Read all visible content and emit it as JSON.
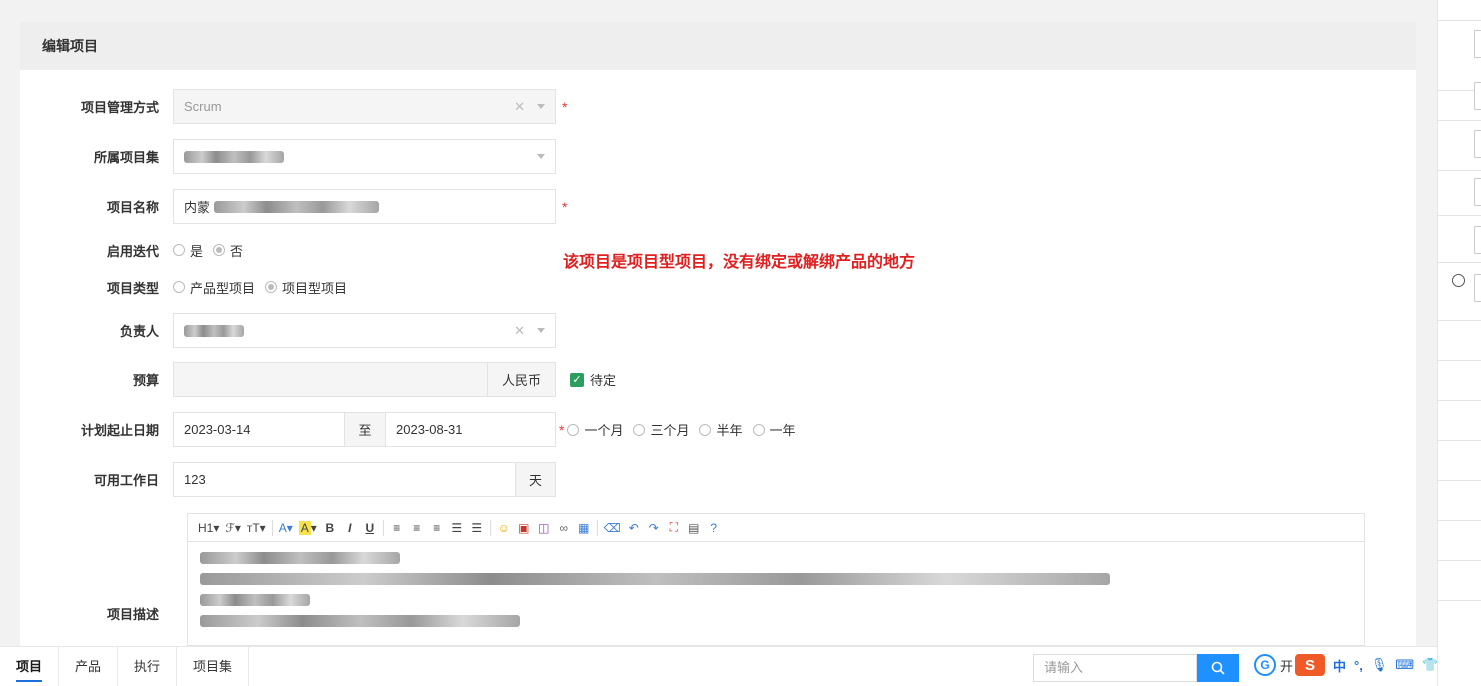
{
  "panel": {
    "title": "编辑项目"
  },
  "form": {
    "management": {
      "label": "项目管理方式",
      "value": "Scrum",
      "required": "*"
    },
    "program": {
      "label": "所属项目集"
    },
    "name": {
      "label": "项目名称",
      "prefix": "内蒙",
      "required": "*"
    },
    "iteration": {
      "label": "启用迭代",
      "options": [
        "是",
        "否"
      ]
    },
    "type": {
      "label": "项目类型",
      "options": [
        "产品型项目",
        "项目型项目"
      ]
    },
    "owner": {
      "label": "负责人"
    },
    "budget": {
      "label": "预算",
      "unit": "人民币",
      "pending": "待定"
    },
    "dates": {
      "label": "计划起止日期",
      "start": "2023-03-14",
      "to": "至",
      "end": "2023-08-31",
      "required": "*",
      "presets": [
        "一个月",
        "三个月",
        "半年",
        "一年"
      ]
    },
    "workdays": {
      "label": "可用工作日",
      "value": "123",
      "unit": "天"
    },
    "description": {
      "label": "项目描述"
    }
  },
  "notice": "该项目是项目型项目，没有绑定或解绑产品的地方",
  "editor": {
    "toolbar": [
      "H1",
      "ℱ",
      "тT",
      "A",
      "A",
      "B",
      "I",
      "U"
    ]
  },
  "bottom": {
    "nav": [
      "项目",
      "产品",
      "执行",
      "项目集"
    ],
    "search_placeholder": "请输入",
    "tray_text": "开",
    "ime_lang": "中"
  },
  "colors": {
    "accent": "#1e90ff",
    "required": "#e33333",
    "notice": "#e02020",
    "check": "#2b9d5e"
  }
}
